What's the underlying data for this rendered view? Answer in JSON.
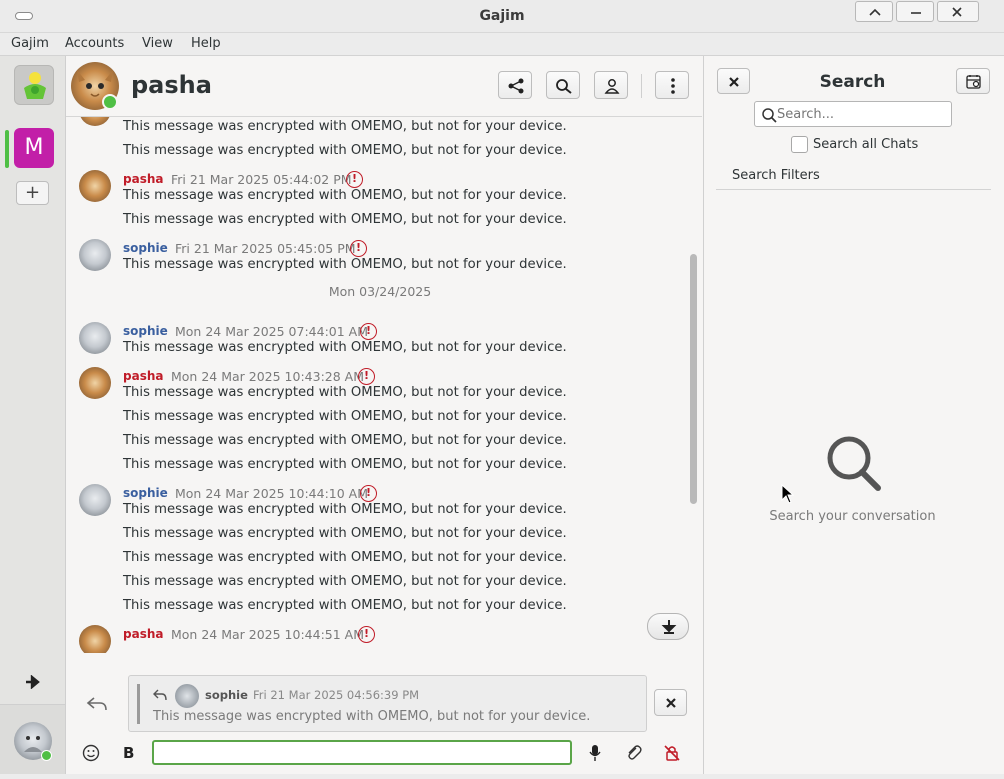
{
  "window": {
    "title": "Gajim"
  },
  "menu": [
    "Gajim",
    "Accounts",
    "View",
    "Help"
  ],
  "accounts": {
    "letter_tile": "M",
    "add_glyph": "+"
  },
  "chat": {
    "contact_name": "pasha",
    "messages": [
      {
        "kind": "cont",
        "text": "This message was encrypted with OMEMO, but not for your device."
      },
      {
        "kind": "cont",
        "text": "This message was encrypted with OMEMO, but not for your device."
      },
      {
        "kind": "head",
        "nick": "pasha",
        "time": "Fri 21 Mar 2025 05:44:02 PM",
        "text": "This message was encrypted with OMEMO, but not for your device."
      },
      {
        "kind": "cont",
        "text": "This message was encrypted with OMEMO, but not for your device."
      },
      {
        "kind": "head",
        "nick": "sophie",
        "time": "Fri 21 Mar 2025 05:45:05 PM",
        "text": "This message was encrypted with OMEMO, but not for your device."
      },
      {
        "kind": "date",
        "text": "Mon 03/24/2025"
      },
      {
        "kind": "head",
        "nick": "sophie",
        "time": "Mon 24 Mar 2025 07:44:01 AM",
        "text": "This message was encrypted with OMEMO, but not for your device."
      },
      {
        "kind": "head",
        "nick": "pasha",
        "time": "Mon 24 Mar 2025 10:43:28 AM",
        "text": "This message was encrypted with OMEMO, but not for your device."
      },
      {
        "kind": "cont",
        "text": "This message was encrypted with OMEMO, but not for your device."
      },
      {
        "kind": "cont",
        "text": "This message was encrypted with OMEMO, but not for your device."
      },
      {
        "kind": "cont",
        "text": "This message was encrypted with OMEMO, but not for your device."
      },
      {
        "kind": "head",
        "nick": "sophie",
        "time": "Mon 24 Mar 2025 10:44:10 AM",
        "text": "This message was encrypted with OMEMO, but not for your device."
      },
      {
        "kind": "cont",
        "text": "This message was encrypted with OMEMO, but not for your device."
      },
      {
        "kind": "cont",
        "text": "This message was encrypted with OMEMO, but not for your device."
      },
      {
        "kind": "cont",
        "text": "This message was encrypted with OMEMO, but not for your device."
      },
      {
        "kind": "cont",
        "text": "This message was encrypted with OMEMO, but not for your device."
      },
      {
        "kind": "headcut",
        "nick": "pasha",
        "time": "Mon 24 Mar 2025 10:44:51 AM"
      }
    ],
    "nick_colors": {
      "pasha": "#c01c28",
      "sophie": "#3a5f9f"
    },
    "reply": {
      "nick": "sophie",
      "time": "Fri 21 Mar 2025 04:56:39 PM",
      "text": "This message was encrypted with OMEMO, but not for your device."
    },
    "input_value": ""
  },
  "search": {
    "title": "Search",
    "placeholder": "Search...",
    "all_chats_label": "Search all Chats",
    "filters_label": "Search Filters",
    "empty_text": "Search your conversation"
  },
  "colors": {
    "accent_green": "#5aa548",
    "account_tile": "#c21fa8",
    "warning": "#c01c28"
  }
}
